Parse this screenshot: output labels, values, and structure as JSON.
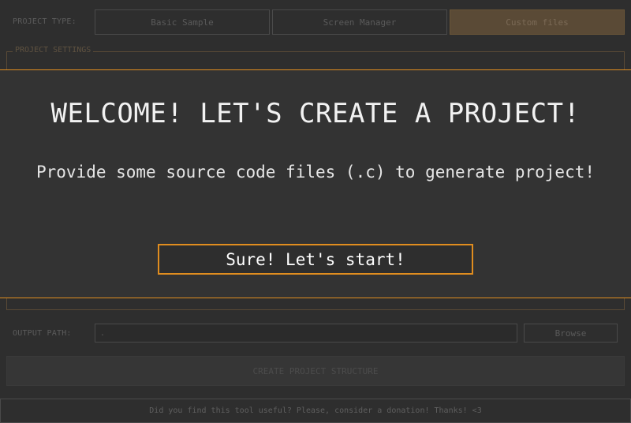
{
  "project_type": {
    "label": "PROJECT TYPE:",
    "options": [
      "Basic Sample",
      "Screen Manager",
      "Custom files"
    ],
    "selected": "Custom files"
  },
  "project_settings": {
    "title": "PROJECT SETTINGS"
  },
  "output": {
    "label": "OUTPUT PATH:",
    "value": ".",
    "browse_label": "Browse"
  },
  "create_button": {
    "label": "CREATE PROJECT STRUCTURE"
  },
  "status_bar": {
    "text": "Did you find this tool useful? Please, consider a donation! Thanks! <3"
  },
  "welcome_modal": {
    "title": "WELCOME! LET'S CREATE A PROJECT!",
    "message": "Provide some source code files (.c) to generate project!",
    "button_label": "Sure! Let's start!"
  },
  "colors": {
    "background": "#2e2e2e",
    "modal_background": "#333333",
    "accent": "#e08d1f",
    "selected_tab": "#5a4a36"
  }
}
